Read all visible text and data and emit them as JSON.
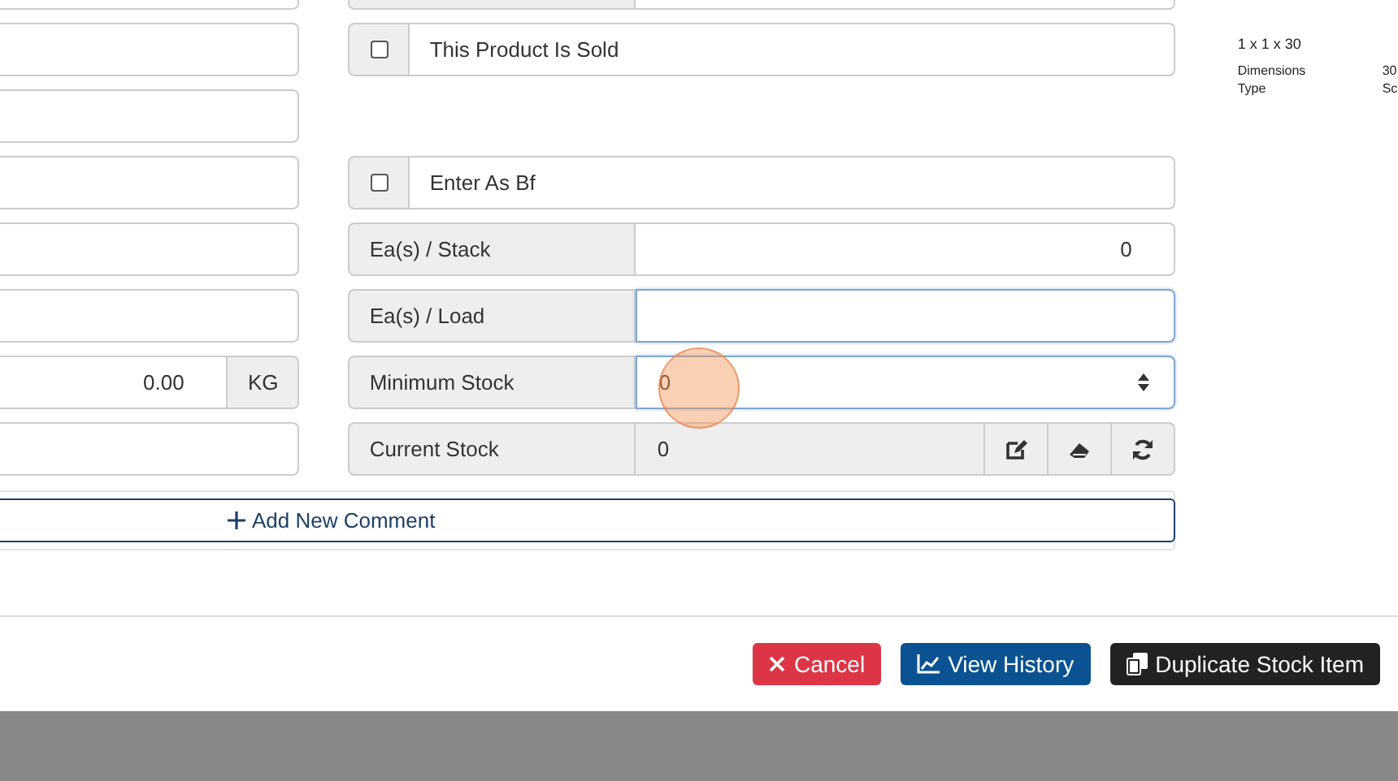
{
  "left_fields": [
    {
      "kind": "input"
    },
    {
      "kind": "input"
    },
    {
      "kind": "input"
    },
    {
      "kind": "input"
    },
    {
      "kind": "input"
    },
    {
      "kind": "input"
    },
    {
      "kind": "unit",
      "value": "0.00",
      "unit": "KG"
    },
    {
      "kind": "input"
    }
  ],
  "right_rows": [
    {
      "kind": "labeled_top"
    },
    {
      "kind": "checkbox",
      "label": "This Product Is Sold",
      "checked": false
    },
    {
      "kind": "spacer"
    },
    {
      "kind": "checkbox",
      "label": "Enter As Bf",
      "checked": false
    },
    {
      "kind": "number",
      "label": "Ea(s) / Stack",
      "value": "0",
      "focused": false
    },
    {
      "kind": "number",
      "label": "Ea(s) / Load",
      "focused": true
    },
    {
      "kind": "spinner",
      "label": "Minimum Stock",
      "value": "0",
      "focused": true
    },
    {
      "kind": "actions",
      "label": "Current Stock",
      "value": "0"
    }
  ],
  "add_comment": {
    "label": "Add New Comment"
  },
  "side_info": {
    "heading": "1 x 1 x 30",
    "rows": [
      {
        "label": "Dimensions",
        "value": "30"
      },
      {
        "label": "Type",
        "value": "Sc"
      }
    ]
  },
  "footer_buttons": [
    {
      "kind": "cancel",
      "label": "Cancel"
    },
    {
      "kind": "history",
      "label": "View History"
    },
    {
      "kind": "duplicate",
      "label": "Duplicate Stock Item"
    }
  ]
}
